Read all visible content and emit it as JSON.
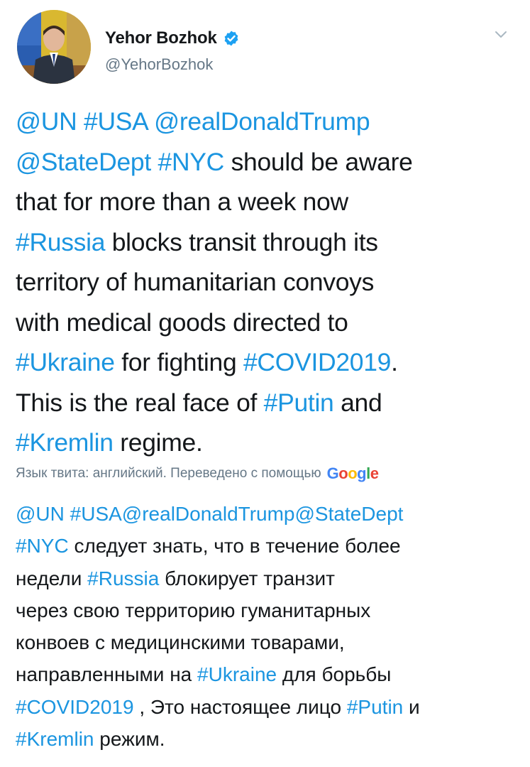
{
  "colors": {
    "text": "#14171a",
    "link": "#1b95e0",
    "secondary": "#657786",
    "verified": "#1da1f2"
  },
  "author": {
    "display_name": "Yehor Bozhok",
    "handle": "@YehorBozhok",
    "verified_icon": "verified-badge-icon",
    "menu_icon": "chevron-down-icon"
  },
  "tweet": {
    "lines": [
      [
        {
          "t": "@UN",
          "link": true
        },
        {
          "t": " "
        },
        {
          "t": "#USA",
          "link": true
        },
        {
          "t": " "
        },
        {
          "t": "@realDonaldTrump",
          "link": true
        }
      ],
      [
        {
          "t": "@StateDept",
          "link": true
        },
        {
          "t": " "
        },
        {
          "t": "#NYC",
          "link": true
        },
        {
          "t": " should be aware"
        }
      ],
      [
        {
          "t": "that for more than a week now"
        }
      ],
      [
        {
          "t": "#Russia",
          "link": true
        },
        {
          "t": " blocks transit through its"
        }
      ],
      [
        {
          "t": "territory of humanitarian convoys"
        }
      ],
      [
        {
          "t": "with medical goods directed to"
        }
      ],
      [
        {
          "t": "#Ukraine",
          "link": true
        },
        {
          "t": " for fighting "
        },
        {
          "t": "#COVID2019",
          "link": true
        },
        {
          "t": "."
        }
      ],
      [
        {
          "t": "This is the real face of "
        },
        {
          "t": "#Putin",
          "link": true
        },
        {
          "t": " and"
        }
      ],
      [
        {
          "t": "#Kremlin",
          "link": true
        },
        {
          "t": " regime."
        }
      ]
    ]
  },
  "translation": {
    "note": "Язык твита: английский. Переведено с помощью",
    "provider": "Google",
    "lines": [
      [
        {
          "t": "@UN",
          "link": true
        },
        {
          "t": " "
        },
        {
          "t": "#USA@realDonaldTrump@StateDept",
          "link": true
        }
      ],
      [
        {
          "t": "#NYC",
          "link": true
        },
        {
          "t": " следует знать, что в течение более"
        }
      ],
      [
        {
          "t": "недели "
        },
        {
          "t": "#Russia",
          "link": true
        },
        {
          "t": " блокирует транзит"
        }
      ],
      [
        {
          "t": "через свою территорию гуманитарных"
        }
      ],
      [
        {
          "t": "конвоев с медицинскими товарами,"
        }
      ],
      [
        {
          "t": "направленными на "
        },
        {
          "t": "#Ukraine",
          "link": true
        },
        {
          "t": " для борьбы"
        }
      ],
      [
        {
          "t": "#COVID2019",
          "link": true
        },
        {
          "t": " , Это настоящее лицо "
        },
        {
          "t": "#Putin",
          "link": true
        },
        {
          "t": " и"
        }
      ],
      [
        {
          "t": "#Kremlin",
          "link": true
        },
        {
          "t": " режим."
        }
      ]
    ]
  }
}
